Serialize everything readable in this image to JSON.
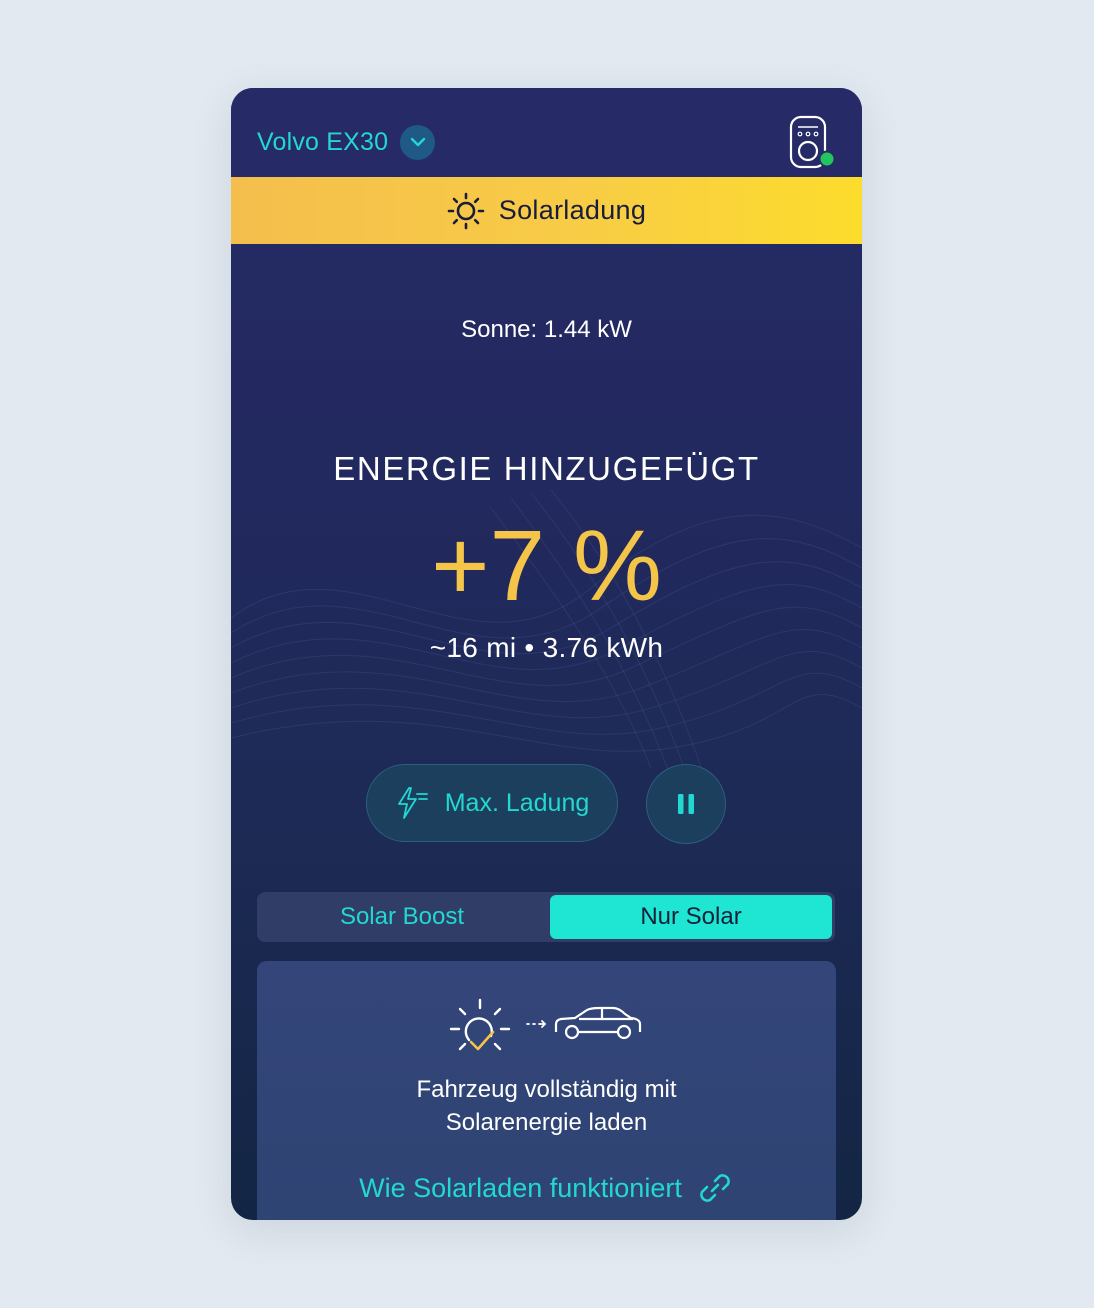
{
  "header": {
    "vehicle_name": "Volvo EX30",
    "dropdown_icon": "chevron-down-icon",
    "charger_icon": "wallbox-charger-icon",
    "charger_status_color": "#22c55e"
  },
  "banner": {
    "icon": "sun-icon",
    "label": "Solarladung",
    "color": "#f8cc46"
  },
  "status": {
    "sun_power": "Sonne: 1.44 kW",
    "energy_title": "ENERGIE HINZUGEFÜGT",
    "energy_value": "+7 %",
    "energy_sub": "~16 mi • 3.76 kWh"
  },
  "controls": {
    "max_charge_label": "Max. Ladung",
    "max_charge_icon": "fast-charge-icon",
    "pause_icon": "pause-icon"
  },
  "mode_toggle": {
    "options": [
      "Solar Boost",
      "Nur Solar"
    ],
    "selected": "Nur Solar"
  },
  "info": {
    "icon": "sun-to-car-icon",
    "text_line1": "Fahrzeug vollständig mit",
    "text_line2": "Solarenergie laden",
    "link_label": "Wie Solarladen funktioniert",
    "link_icon": "link-icon"
  },
  "colors": {
    "accent": "#22d8d0",
    "highlight": "#f5c54a",
    "background": "#262a66"
  }
}
